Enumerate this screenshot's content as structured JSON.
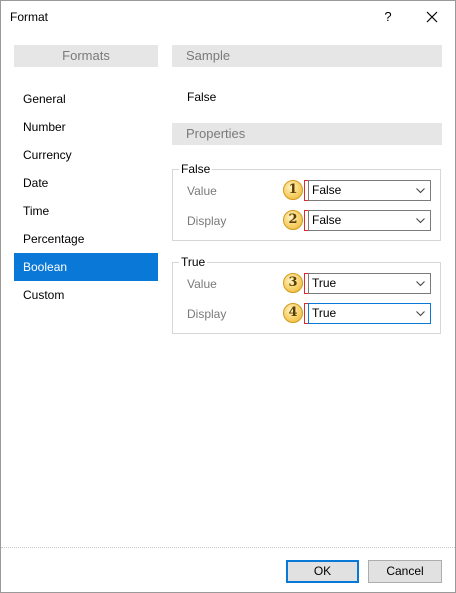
{
  "window": {
    "title": "Format",
    "help_label": "?"
  },
  "formats": {
    "header": "Formats",
    "items": [
      {
        "label": "General",
        "selected": false
      },
      {
        "label": "Number",
        "selected": false
      },
      {
        "label": "Currency",
        "selected": false
      },
      {
        "label": "Date",
        "selected": false
      },
      {
        "label": "Time",
        "selected": false
      },
      {
        "label": "Percentage",
        "selected": false
      },
      {
        "label": "Boolean",
        "selected": true
      },
      {
        "label": "Custom",
        "selected": false
      }
    ],
    "selected_color": "#0A78D7"
  },
  "sample": {
    "header": "Sample",
    "value": "False"
  },
  "properties": {
    "header": "Properties",
    "false_group": {
      "legend": "False",
      "value_label": "Value",
      "value_callout": "1",
      "value_selected": "False",
      "display_label": "Display",
      "display_callout": "2",
      "display_selected": "False"
    },
    "true_group": {
      "legend": "True",
      "value_label": "Value",
      "value_callout": "3",
      "value_selected": "True",
      "display_label": "Display",
      "display_callout": "4",
      "display_selected": "True"
    },
    "callout_color": "#F7D067",
    "bracket_color": "#D62E2E"
  },
  "buttons": {
    "ok": "OK",
    "cancel": "Cancel"
  },
  "icons": {
    "close": "close-icon",
    "dropdown": "chevron-down-icon"
  }
}
